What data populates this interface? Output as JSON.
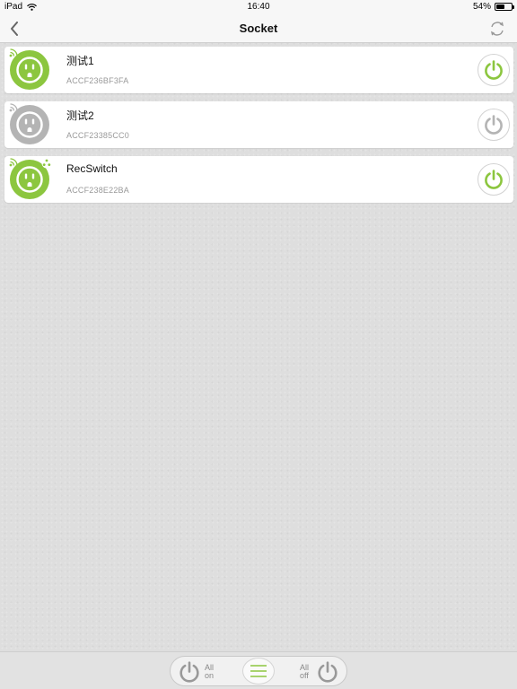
{
  "status_bar": {
    "device": "iPad",
    "time": "16:40",
    "battery_text": "54%",
    "battery_level": 0.54
  },
  "nav": {
    "title": "Socket",
    "back_icon": "chevron-left-icon",
    "refresh_icon": "refresh-icon"
  },
  "colors": {
    "on": "#8cc63f",
    "off": "#b4b4b4",
    "accent": "#8cc63f"
  },
  "devices": [
    {
      "name": "测试1",
      "mac": "ACCF236BF3FA",
      "state": "on",
      "timer": false
    },
    {
      "name": "测试2",
      "mac": "ACCF23385CC0",
      "state": "off",
      "timer": false
    },
    {
      "name": "RecSwitch",
      "mac": "ACCF238E22BA",
      "state": "on",
      "timer": true
    }
  ],
  "bottom_bar": {
    "all_on_line1": "All",
    "all_on_line2": "on",
    "all_off_line1": "All",
    "all_off_line2": "off",
    "menu_icon": "menu-icon"
  }
}
